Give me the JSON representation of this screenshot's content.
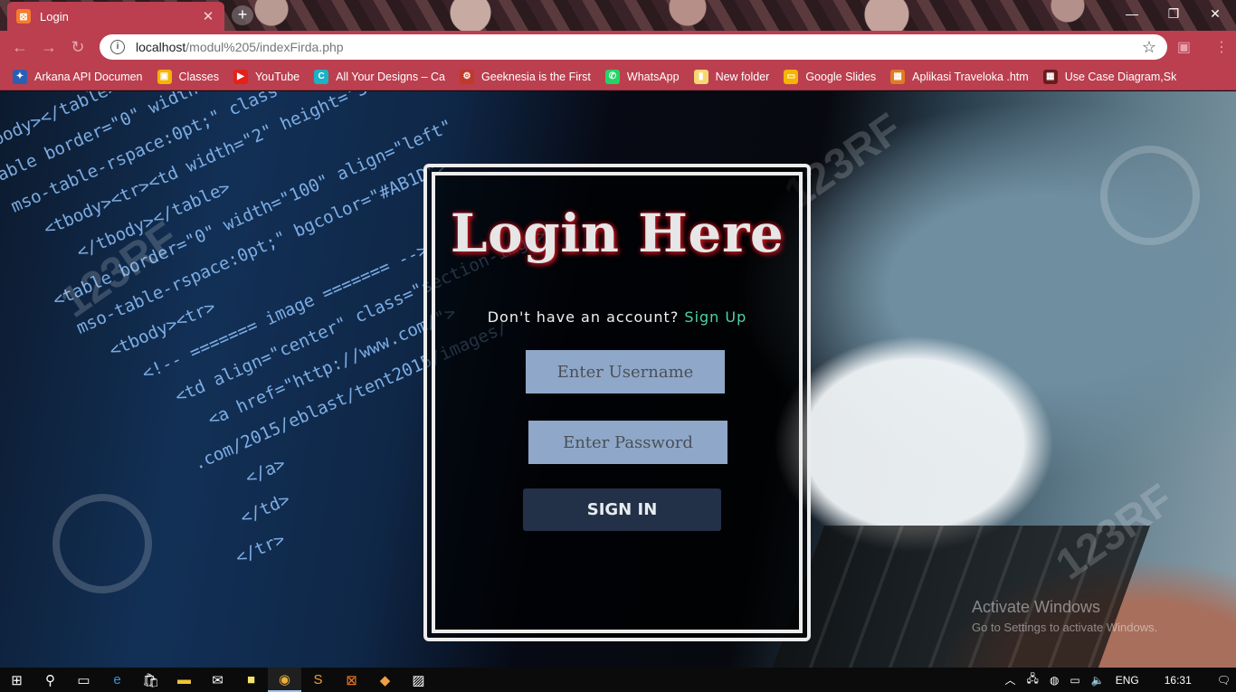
{
  "browser": {
    "tab_title": "Login",
    "tab_favicon": "xampp-icon",
    "url_host": "localhost",
    "url_path": "/modul%205/indexFirda.php",
    "bookmarks": [
      {
        "label": "Arkana API Documen",
        "icon": "arkana-icon",
        "color": "#2b5fb3"
      },
      {
        "label": "Classes",
        "icon": "classroom-icon",
        "color": "#f4b400"
      },
      {
        "label": "YouTube",
        "icon": "youtube-icon",
        "color": "#e62117"
      },
      {
        "label": "All Your Designs – Ca",
        "icon": "canva-icon",
        "color": "#1ab3c4"
      },
      {
        "label": "Geeknesia is the First",
        "icon": "geeknesia-icon",
        "color": "#c0392b"
      },
      {
        "label": "WhatsApp",
        "icon": "whatsapp-icon",
        "color": "#25d366"
      },
      {
        "label": "New folder",
        "icon": "folder-icon",
        "color": "#f7d774"
      },
      {
        "label": "Google Slides",
        "icon": "slides-icon",
        "color": "#f4b400"
      },
      {
        "label": "Aplikasi Traveloka .htm",
        "icon": "file-icon",
        "color": "#e07b22"
      },
      {
        "label": "Use Case Diagram,Sk",
        "icon": "diagram-icon",
        "color": "#6a1b1b"
      }
    ]
  },
  "login": {
    "title": "Login Here",
    "signup_prompt": "Don't have an account?",
    "signup_link": "Sign Up",
    "username_placeholder": "Enter Username",
    "password_placeholder": "Enter Password",
    "signin_label": "SIGN IN"
  },
  "watermark": {
    "activate_title": "Activate Windows",
    "activate_sub": "Go to Settings to activate Windows."
  },
  "taskbar": {
    "language": "ENG",
    "time": "16:31"
  },
  "colors": {
    "chrome_accent": "#bb3f4f",
    "title_glow": "#c0141e",
    "signup_link": "#4fd3a3",
    "input_bg": "#aecdf5",
    "button_bg": "#283852"
  }
}
